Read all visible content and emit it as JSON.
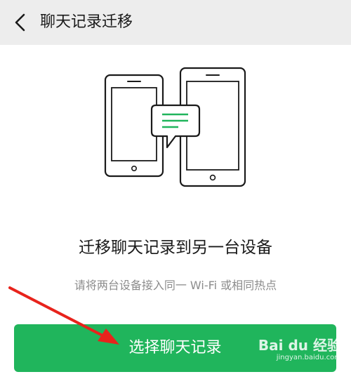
{
  "header": {
    "title": "聊天记录迁移",
    "back_icon": "chevron-left-icon"
  },
  "illustration": {
    "left_device": "phone-icon",
    "right_device": "tablet-icon",
    "bubble": "message-bubble-icon",
    "accent_color": "#20b55c"
  },
  "main": {
    "headline": "迁移聊天记录到另一台设备",
    "subline": "请将两台设备接入同一 Wi-Fi 或相同热点"
  },
  "action": {
    "button_label": "选择聊天记录",
    "button_color": "#20b55c"
  },
  "annotation": {
    "arrow_color": "#e8231c"
  },
  "watermark": {
    "logo_text": "Bai du 经验",
    "url": "jingyan.baidu.com"
  }
}
